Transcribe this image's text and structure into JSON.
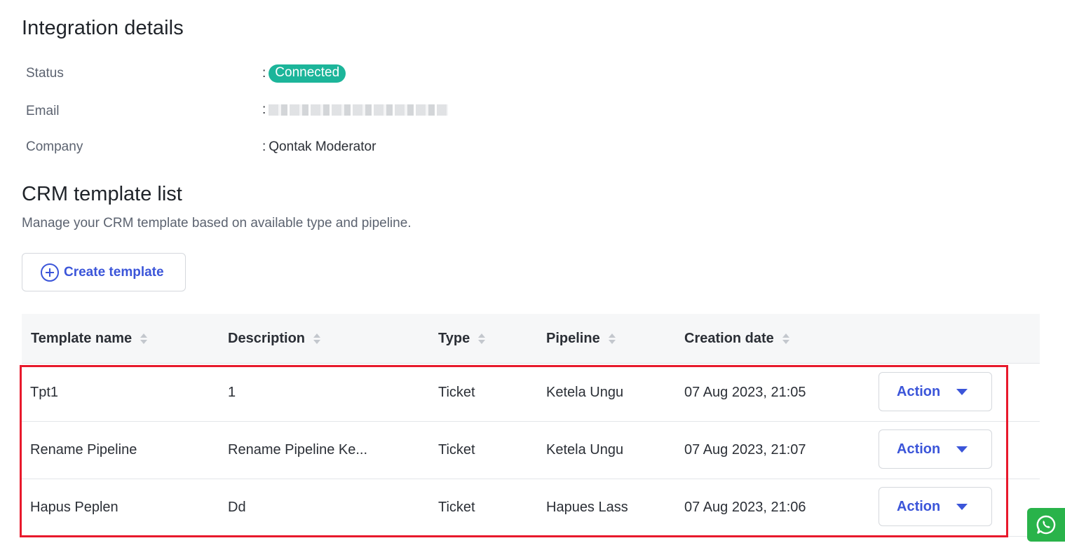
{
  "integration": {
    "title": "Integration details",
    "status_label": "Status",
    "status_value": "Connected",
    "email_label": "Email",
    "company_label": "Company",
    "company_value": "Qontak Moderator",
    "separator": ":"
  },
  "crm": {
    "title": "CRM template list",
    "subtitle": "Manage your CRM template based on available type and pipeline.",
    "create_label": "Create template"
  },
  "table": {
    "columns": [
      "Template name",
      "Description",
      "Type",
      "Pipeline",
      "Creation date"
    ],
    "rows": [
      {
        "name": "Tpt1",
        "description": "1",
        "type": "Ticket",
        "pipeline": "Ketela Ungu",
        "date": "07 Aug 2023, 21:05",
        "action": "Action"
      },
      {
        "name": "Rename Pipeline",
        "description": "Rename Pipeline Ke...",
        "type": "Ticket",
        "pipeline": "Ketela Ungu",
        "date": "07 Aug 2023, 21:07",
        "action": "Action"
      },
      {
        "name": "Hapus Peplen",
        "description": "Dd",
        "type": "Ticket",
        "pipeline": "Hapues Lass",
        "date": "07 Aug 2023, 21:06",
        "action": "Action"
      }
    ]
  },
  "colors": {
    "accent": "#3b55d9",
    "status_badge": "#1cb59a",
    "highlight": "#e8192c",
    "whatsapp": "#29b34a"
  },
  "icons": {
    "create": "plus-circle-icon",
    "sort": "sort-icon",
    "action_caret": "caret-down-icon",
    "floating": "whatsapp-icon"
  }
}
